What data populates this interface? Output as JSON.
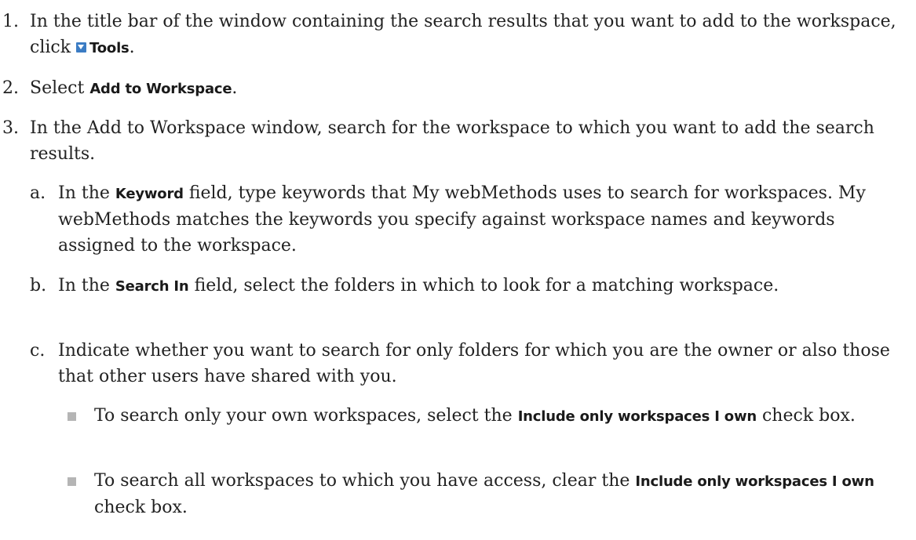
{
  "steps": [
    {
      "num": "1.",
      "text_before": "In the title bar of the window containing the search results that you want to add to the workspace, click",
      "icon": "dropdown-arrow-icon",
      "bold": "Tools",
      "text_after": "."
    },
    {
      "num": "2.",
      "text_before": "Select",
      "bold": "Add to Workspace",
      "text_after": "."
    },
    {
      "num": "3.",
      "text": "In the Add to Workspace window, search for the workspace to which you want to add the search results.",
      "substeps": [
        {
          "num": "a.",
          "text_before": "In the",
          "bold": "Keyword",
          "text_after": "field, type keywords that My webMethods uses to search for workspaces. My webMethods matches the keywords you specify against workspace names and keywords assigned to the workspace."
        },
        {
          "num": "b.",
          "text_before": "In the",
          "bold": "Search In",
          "text_after": "field, select the folders in which to look for a matching workspace."
        },
        {
          "num": "c.",
          "text": "Indicate whether you want to search for only folders for which you are the owner or also those that other users have shared with you.",
          "bullets": [
            {
              "text_before": "To search only your own workspaces, select the",
              "bold": "Include only workspaces I own",
              "text_after": "check box."
            },
            {
              "text_before": "To search all workspaces to which you have access, clear the",
              "bold": "Include only workspaces I own",
              "text_after": "check box."
            }
          ]
        }
      ]
    }
  ],
  "colors": {
    "text": "#222222",
    "icon": "#3b7cc4",
    "bullet": "#b5b5b5"
  }
}
